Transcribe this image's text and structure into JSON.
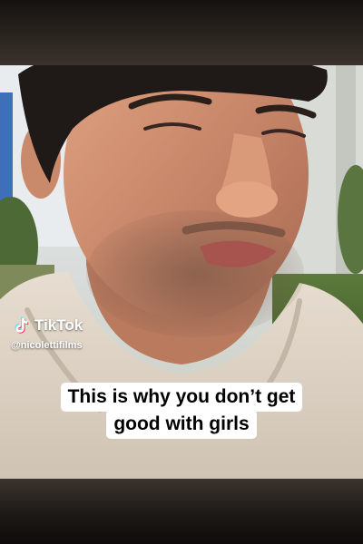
{
  "watermark": {
    "brand": "TikTok",
    "handle": "@nicolettifilms",
    "icon": "tiktok-note-icon"
  },
  "caption": {
    "line1": "This is why you don’t get",
    "line2": "good with girls"
  },
  "colors": {
    "caption_bg": "#ffffff",
    "caption_text": "#000000",
    "watermark_text": "#ffffff",
    "letterbox": "#1a1613"
  }
}
